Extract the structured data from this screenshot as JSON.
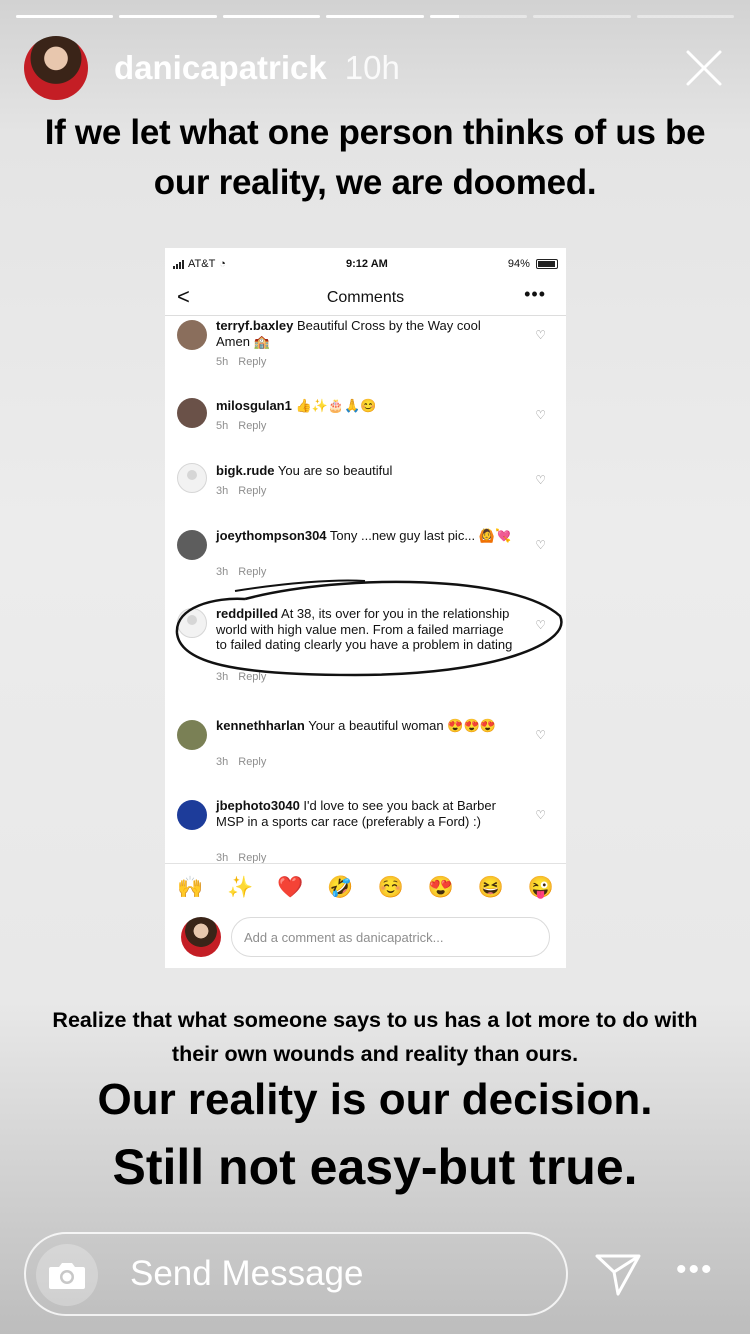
{
  "story": {
    "progress": [
      1,
      1,
      1,
      1,
      0.3,
      0,
      0
    ],
    "username": "danicapatrick",
    "time": "10h",
    "headline": "If we let what one person thinks of us be our reality, we are doomed."
  },
  "screenshot": {
    "status": {
      "carrier": "AT&T",
      "time": "9:12 AM",
      "battery": "94%"
    },
    "nav": {
      "back": "<",
      "title": "Comments",
      "more": "•••"
    },
    "comments": [
      {
        "user": "terryf.baxley",
        "text": "Beautiful Cross by the Way cool Amen 🏫",
        "time": "5h",
        "reply": "Reply"
      },
      {
        "user": "milosgulan1",
        "text": "👍✨🎂🙏😊",
        "time": "5h",
        "reply": "Reply"
      },
      {
        "user": "bigk.rude",
        "text": "You are so beautiful",
        "time": "3h",
        "reply": "Reply"
      },
      {
        "user": "joeythompson304",
        "text": "Tony ...new guy last pic... 🙆💘",
        "time": "3h",
        "reply": "Reply"
      },
      {
        "user": "reddpilled",
        "text": "At 38, its over for you in the relationship world with high value men. From a failed marriage to failed dating clearly you have a problem in dating",
        "time": "3h",
        "reply": "Reply"
      },
      {
        "user": "kennethharlan",
        "text": "Your a beautiful woman 😍😍😍",
        "time": "3h",
        "reply": "Reply"
      },
      {
        "user": "jbephoto3040",
        "text": "I'd love to see you back at Barber MSP in a sports car race (preferably a Ford) :)",
        "time": "3h",
        "reply": "Reply"
      }
    ],
    "emojis": [
      "🙌",
      "✨",
      "❤️",
      "🤣",
      "☺️",
      "😍",
      "😆",
      "😜"
    ],
    "comment_placeholder": "Add a comment as danicapatrick..."
  },
  "caption": "Realize that what someone says to us has a lot more to do with their own wounds and reality than ours.",
  "big_line_1": "Our reality is our decision.",
  "big_line_2": "Still not easy-but true.",
  "reply": {
    "placeholder": "Send Message"
  },
  "colors": {
    "ellipse": "#111111",
    "meta_gray": "#8e8e8e"
  }
}
